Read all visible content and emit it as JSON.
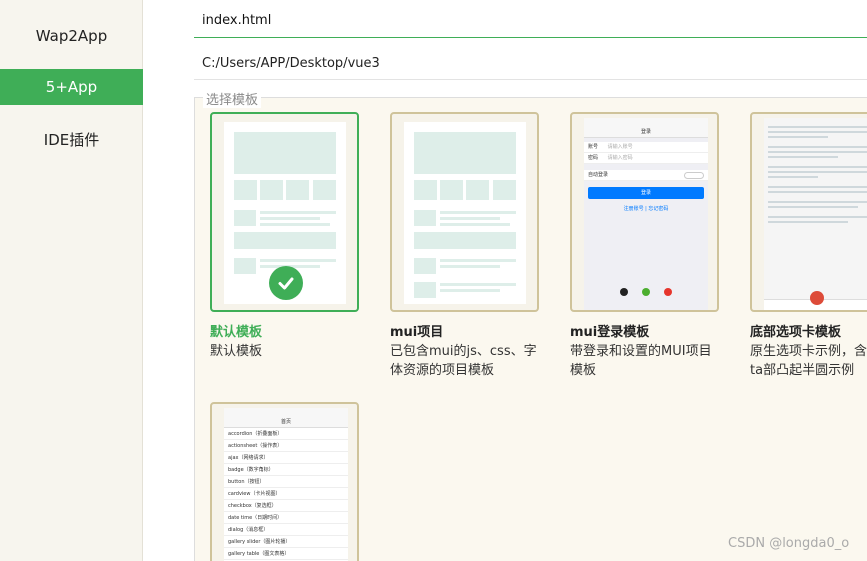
{
  "sidebar": {
    "items": [
      {
        "label": "Wap2App",
        "active": false
      },
      {
        "label": "5+App",
        "active": true
      },
      {
        "label": "IDE插件",
        "active": false
      }
    ]
  },
  "form": {
    "name_value": "index.html",
    "path_value": "C:/Users/APP/Desktop/vue3"
  },
  "templates": {
    "legend": "选择模板",
    "cards": [
      {
        "title": "默认模板",
        "desc": "默认模板",
        "selected": true
      },
      {
        "title": "mui项目",
        "desc": "已包含mui的js、css、字体资源的项目模板",
        "selected": false
      },
      {
        "title": "mui登录模板",
        "desc": "带登录和设置的MUI项目模板",
        "selected": false
      },
      {
        "title": "底部选项卡模板",
        "desc": "原生选项卡示例，含ta部凸起半圆示例",
        "selected": false
      },
      {
        "title": "",
        "desc": "",
        "selected": false
      }
    ]
  },
  "login_mock": {
    "title": "登录",
    "account_label": "账号",
    "account_placeholder": "请输入账号",
    "password_label": "密码",
    "password_placeholder": "请输入密码",
    "auto_login": "自动登录",
    "login_button": "登录",
    "links": "注册账号 | 忘记密码"
  },
  "list_mock": {
    "title": "首页",
    "items": [
      "accordion（折叠面板）",
      "actionsheet（操作表）",
      "ajax（网络请求）",
      "badge（数字角标）",
      "button（按钮）",
      "cardview（卡片视图）",
      "checkbox（复选框）",
      "date time（日期时间）",
      "dialog（消息框）",
      "gallery slider（图片轮播）",
      "gallery table（图文表格）"
    ]
  },
  "watermark": "CSDN @longda0_o",
  "colors": {
    "accent": "#3fae57",
    "card_border": "#cfc39a",
    "sketch": "#deeee9"
  }
}
